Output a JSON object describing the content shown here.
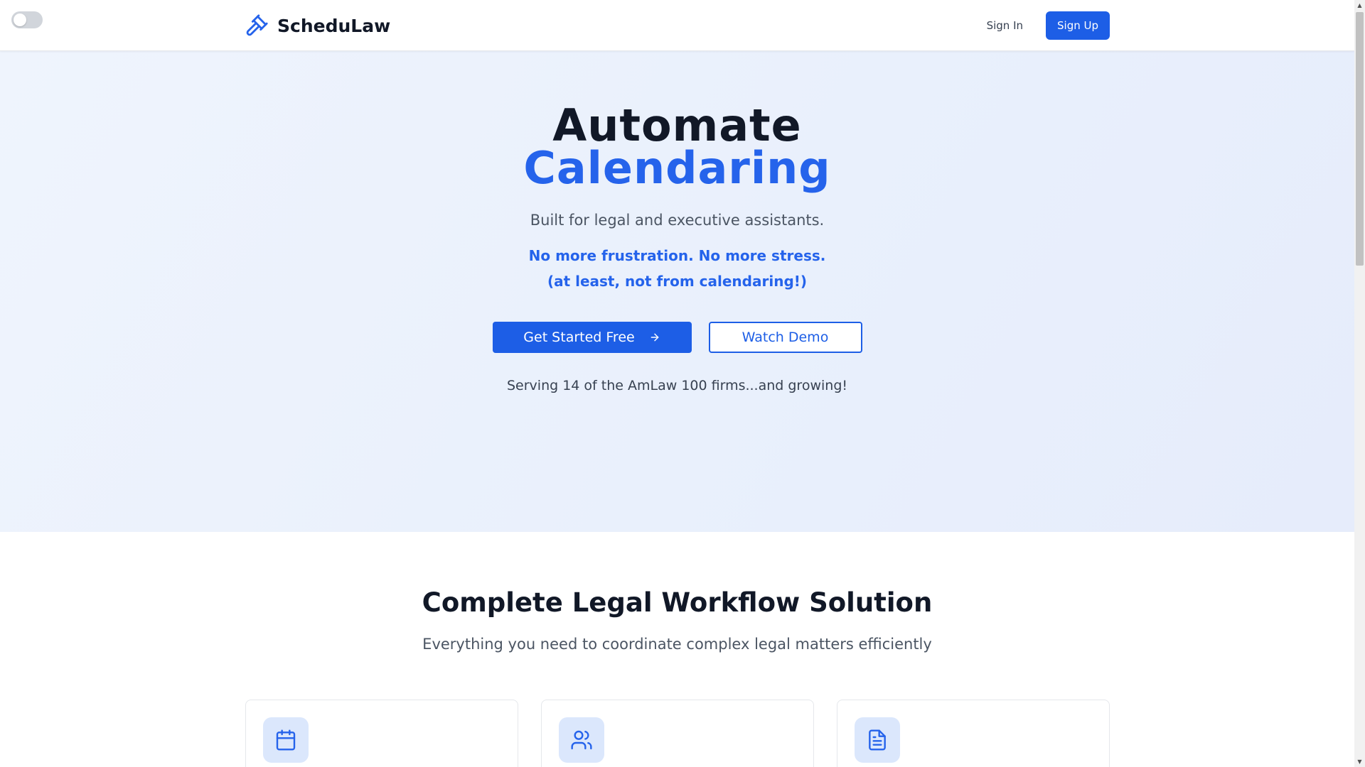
{
  "header": {
    "brand_name": "ScheduLaw",
    "brand_icon": "gavel-icon",
    "sign_in": "Sign In",
    "sign_up": "Sign Up",
    "theme_toggle": "off"
  },
  "hero": {
    "title_line1": "Automate",
    "title_line2": "Calendaring",
    "subtitle": "Built for legal and executive assistants.",
    "tagline1": "No more frustration. No more stress.",
    "tagline2": "(at least, not from calendaring!)",
    "cta_primary": "Get Started Free",
    "cta_primary_icon": "arrow-right-icon",
    "cta_secondary": "Watch Demo",
    "serving": "Serving 14 of the AmLaw 100 firms...and growing!"
  },
  "features": {
    "title": "Complete Legal Workflow Solution",
    "subtitle": "Everything you need to coordinate complex legal matters efficiently",
    "cards": [
      {
        "icon": "calendar-icon"
      },
      {
        "icon": "users-icon"
      },
      {
        "icon": "document-icon"
      }
    ]
  },
  "colors": {
    "accent": "#1d5ee6",
    "accent_text": "#2563eb",
    "hero_bg": "#eaf1fd",
    "text_dark": "#111827",
    "text_muted": "#4b5563"
  }
}
